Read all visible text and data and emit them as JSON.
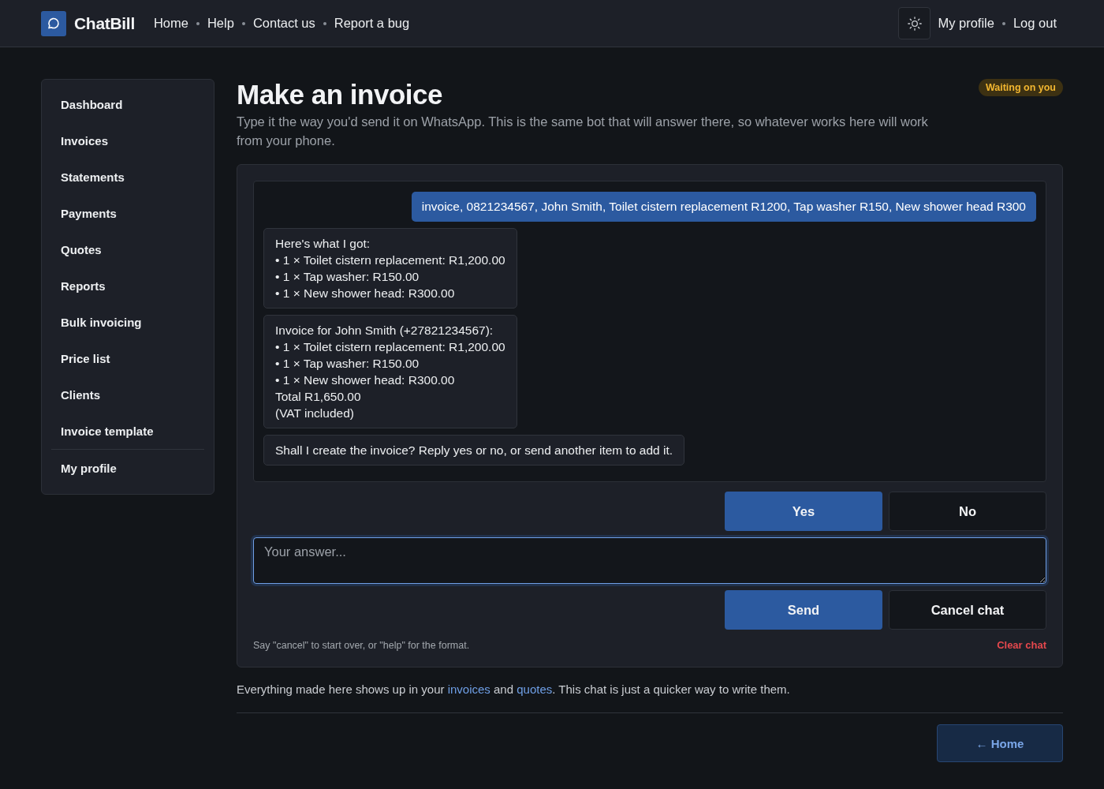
{
  "header": {
    "brand": "ChatBill",
    "nav": [
      "Home",
      "Help",
      "Contact us",
      "Report a bug"
    ],
    "account_links": [
      "My profile",
      "Log out"
    ]
  },
  "sidebar": {
    "items": [
      "Dashboard",
      "Invoices",
      "Statements",
      "Payments",
      "Quotes",
      "Reports",
      "Bulk invoicing",
      "Price list",
      "Clients",
      "Invoice template"
    ],
    "bottom_items": [
      "My profile"
    ]
  },
  "page": {
    "title": "Make an invoice",
    "subtitle": "Type it the way you'd send it on WhatsApp. This is the same bot that will answer there, so whatever works here will work from your phone.",
    "status_badge": "Waiting on you"
  },
  "chat": {
    "messages": [
      {
        "kind": "user",
        "text": "invoice, 0821234567, John Smith, Toilet cistern replacement R1200, Tap washer R150, New shower head R300"
      },
      {
        "kind": "bot",
        "text": "Here's what I got:\n• 1 × Toilet cistern replacement: R1,200.00\n• 1 × Tap washer: R150.00\n• 1 × New shower head: R300.00"
      },
      {
        "kind": "bot",
        "text": "Invoice for John Smith (+27821234567):\n• 1 × Toilet cistern replacement: R1,200.00\n• 1 × Tap washer: R150.00\n• 1 × New shower head: R300.00\nTotal R1,650.00\n(VAT included)"
      },
      {
        "kind": "bot",
        "text": "Shall I create the invoice? Reply yes or no, or send another item to add it."
      }
    ],
    "quick_replies": [
      {
        "label": "Yes",
        "kind": "primary"
      },
      {
        "label": "No",
        "kind": "secondary"
      }
    ],
    "answer": {
      "placeholder": "Your answer..."
    },
    "actions": [
      {
        "label": "Send",
        "kind": "primary"
      },
      {
        "label": "Cancel chat",
        "kind": "secondary"
      }
    ],
    "hint": "Say \"cancel\" to start over, or \"help\" for the format.",
    "clear_link": "Clear chat"
  },
  "footnote": [
    {
      "kind": "text",
      "text": "Everything made here shows up in your "
    },
    {
      "kind": "link",
      "text": "invoices"
    },
    {
      "kind": "text",
      "text": " and "
    },
    {
      "kind": "link",
      "text": "quotes"
    },
    {
      "kind": "text",
      "text": ". This chat is just a quicker way to write them."
    }
  ],
  "back_button": "← Home"
}
